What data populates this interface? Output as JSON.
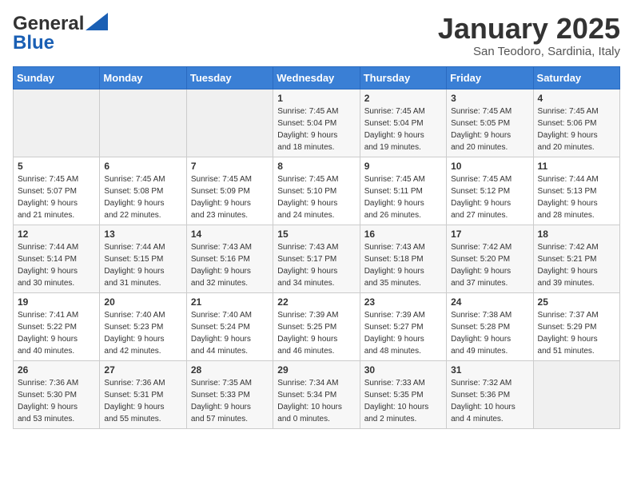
{
  "header": {
    "logo_line1": "General",
    "logo_line2": "Blue",
    "month": "January 2025",
    "location": "San Teodoro, Sardinia, Italy"
  },
  "weekdays": [
    "Sunday",
    "Monday",
    "Tuesday",
    "Wednesday",
    "Thursday",
    "Friday",
    "Saturday"
  ],
  "weeks": [
    [
      {
        "day": "",
        "info": ""
      },
      {
        "day": "",
        "info": ""
      },
      {
        "day": "",
        "info": ""
      },
      {
        "day": "1",
        "info": "Sunrise: 7:45 AM\nSunset: 5:04 PM\nDaylight: 9 hours\nand 18 minutes."
      },
      {
        "day": "2",
        "info": "Sunrise: 7:45 AM\nSunset: 5:04 PM\nDaylight: 9 hours\nand 19 minutes."
      },
      {
        "day": "3",
        "info": "Sunrise: 7:45 AM\nSunset: 5:05 PM\nDaylight: 9 hours\nand 20 minutes."
      },
      {
        "day": "4",
        "info": "Sunrise: 7:45 AM\nSunset: 5:06 PM\nDaylight: 9 hours\nand 20 minutes."
      }
    ],
    [
      {
        "day": "5",
        "info": "Sunrise: 7:45 AM\nSunset: 5:07 PM\nDaylight: 9 hours\nand 21 minutes."
      },
      {
        "day": "6",
        "info": "Sunrise: 7:45 AM\nSunset: 5:08 PM\nDaylight: 9 hours\nand 22 minutes."
      },
      {
        "day": "7",
        "info": "Sunrise: 7:45 AM\nSunset: 5:09 PM\nDaylight: 9 hours\nand 23 minutes."
      },
      {
        "day": "8",
        "info": "Sunrise: 7:45 AM\nSunset: 5:10 PM\nDaylight: 9 hours\nand 24 minutes."
      },
      {
        "day": "9",
        "info": "Sunrise: 7:45 AM\nSunset: 5:11 PM\nDaylight: 9 hours\nand 26 minutes."
      },
      {
        "day": "10",
        "info": "Sunrise: 7:45 AM\nSunset: 5:12 PM\nDaylight: 9 hours\nand 27 minutes."
      },
      {
        "day": "11",
        "info": "Sunrise: 7:44 AM\nSunset: 5:13 PM\nDaylight: 9 hours\nand 28 minutes."
      }
    ],
    [
      {
        "day": "12",
        "info": "Sunrise: 7:44 AM\nSunset: 5:14 PM\nDaylight: 9 hours\nand 30 minutes."
      },
      {
        "day": "13",
        "info": "Sunrise: 7:44 AM\nSunset: 5:15 PM\nDaylight: 9 hours\nand 31 minutes."
      },
      {
        "day": "14",
        "info": "Sunrise: 7:43 AM\nSunset: 5:16 PM\nDaylight: 9 hours\nand 32 minutes."
      },
      {
        "day": "15",
        "info": "Sunrise: 7:43 AM\nSunset: 5:17 PM\nDaylight: 9 hours\nand 34 minutes."
      },
      {
        "day": "16",
        "info": "Sunrise: 7:43 AM\nSunset: 5:18 PM\nDaylight: 9 hours\nand 35 minutes."
      },
      {
        "day": "17",
        "info": "Sunrise: 7:42 AM\nSunset: 5:20 PM\nDaylight: 9 hours\nand 37 minutes."
      },
      {
        "day": "18",
        "info": "Sunrise: 7:42 AM\nSunset: 5:21 PM\nDaylight: 9 hours\nand 39 minutes."
      }
    ],
    [
      {
        "day": "19",
        "info": "Sunrise: 7:41 AM\nSunset: 5:22 PM\nDaylight: 9 hours\nand 40 minutes."
      },
      {
        "day": "20",
        "info": "Sunrise: 7:40 AM\nSunset: 5:23 PM\nDaylight: 9 hours\nand 42 minutes."
      },
      {
        "day": "21",
        "info": "Sunrise: 7:40 AM\nSunset: 5:24 PM\nDaylight: 9 hours\nand 44 minutes."
      },
      {
        "day": "22",
        "info": "Sunrise: 7:39 AM\nSunset: 5:25 PM\nDaylight: 9 hours\nand 46 minutes."
      },
      {
        "day": "23",
        "info": "Sunrise: 7:39 AM\nSunset: 5:27 PM\nDaylight: 9 hours\nand 48 minutes."
      },
      {
        "day": "24",
        "info": "Sunrise: 7:38 AM\nSunset: 5:28 PM\nDaylight: 9 hours\nand 49 minutes."
      },
      {
        "day": "25",
        "info": "Sunrise: 7:37 AM\nSunset: 5:29 PM\nDaylight: 9 hours\nand 51 minutes."
      }
    ],
    [
      {
        "day": "26",
        "info": "Sunrise: 7:36 AM\nSunset: 5:30 PM\nDaylight: 9 hours\nand 53 minutes."
      },
      {
        "day": "27",
        "info": "Sunrise: 7:36 AM\nSunset: 5:31 PM\nDaylight: 9 hours\nand 55 minutes."
      },
      {
        "day": "28",
        "info": "Sunrise: 7:35 AM\nSunset: 5:33 PM\nDaylight: 9 hours\nand 57 minutes."
      },
      {
        "day": "29",
        "info": "Sunrise: 7:34 AM\nSunset: 5:34 PM\nDaylight: 10 hours\nand 0 minutes."
      },
      {
        "day": "30",
        "info": "Sunrise: 7:33 AM\nSunset: 5:35 PM\nDaylight: 10 hours\nand 2 minutes."
      },
      {
        "day": "31",
        "info": "Sunrise: 7:32 AM\nSunset: 5:36 PM\nDaylight: 10 hours\nand 4 minutes."
      },
      {
        "day": "",
        "info": ""
      }
    ]
  ]
}
